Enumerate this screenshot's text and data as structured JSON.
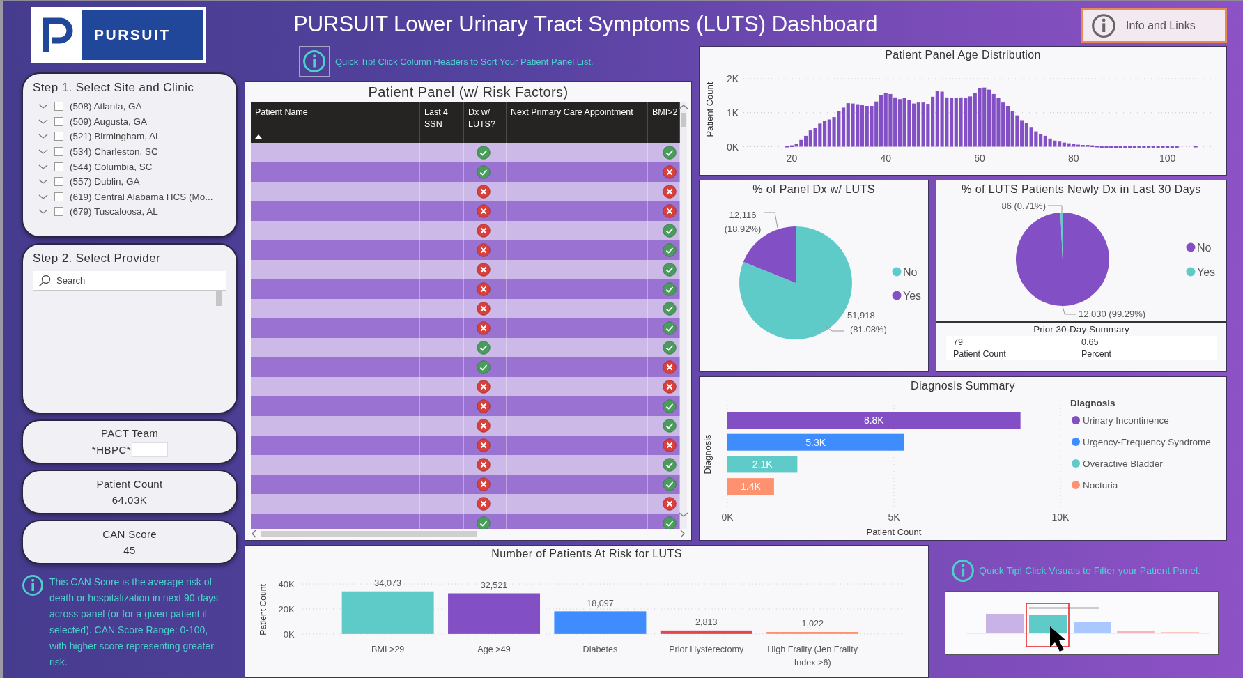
{
  "header": {
    "logo_text": "PURSUIT",
    "title": "PURSUIT Lower Urinary Tract Symptoms (LUTS) Dashboard",
    "info_button": "Info and Links"
  },
  "site_filter": {
    "title": "Step 1. Select Site and Clinic",
    "items": [
      {
        "label": "(508) Atlanta, GA",
        "checked": false
      },
      {
        "label": "(509) Augusta, GA",
        "checked": false
      },
      {
        "label": "(521) Birmingham, AL",
        "checked": false
      },
      {
        "label": "(534) Charleston, SC",
        "checked": false
      },
      {
        "label": "(544) Columbia, SC",
        "checked": false
      },
      {
        "label": "(557) Dublin, GA",
        "checked": false
      },
      {
        "label": "(619) Central Alabama HCS (Mo...",
        "checked": false
      },
      {
        "label": "(679) Tuscaloosa, AL",
        "checked": false
      }
    ]
  },
  "provider_filter": {
    "title": "Step 2. Select Provider",
    "search": {
      "placeholder": "Search"
    }
  },
  "cards": [
    {
      "label": "PACT Team",
      "value": "*HBPC*",
      "redacted": true
    },
    {
      "label": "Patient Count",
      "value": "64.03K",
      "redacted": false
    },
    {
      "label": "CAN Score",
      "value": "45",
      "redacted": false
    }
  ],
  "can_note": "This CAN Score is the average risk of death or hospitalization in next 90 days across panel (or for a given patient if selected). CAN Score Range: 0-100, with higher score representing greater risk.",
  "table_tip": "Quick Tip! Click Column Headers to Sort Your Patient Panel List.",
  "patient_panel": {
    "title": "Patient Panel (w/ Risk Factors)",
    "columns": [
      {
        "label": "Patient Name",
        "sorted": true
      },
      {
        "label": "Last 4 SSN",
        "sorted": false
      },
      {
        "label": "Dx w/ LUTS?",
        "sorted": false
      },
      {
        "label": "Next Primary Care Appointment",
        "sorted": false
      },
      {
        "label": "BMI>2",
        "sorted": false
      }
    ],
    "rows": [
      {
        "dx_luts": true,
        "bmi_over_29": true
      },
      {
        "dx_luts": true,
        "bmi_over_29": false
      },
      {
        "dx_luts": false,
        "bmi_over_29": false
      },
      {
        "dx_luts": false,
        "bmi_over_29": false
      },
      {
        "dx_luts": false,
        "bmi_over_29": true
      },
      {
        "dx_luts": false,
        "bmi_over_29": true
      },
      {
        "dx_luts": false,
        "bmi_over_29": true
      },
      {
        "dx_luts": false,
        "bmi_over_29": true
      },
      {
        "dx_luts": false,
        "bmi_over_29": true
      },
      {
        "dx_luts": false,
        "bmi_over_29": true
      },
      {
        "dx_luts": true,
        "bmi_over_29": true
      },
      {
        "dx_luts": true,
        "bmi_over_29": false
      },
      {
        "dx_luts": false,
        "bmi_over_29": false
      },
      {
        "dx_luts": false,
        "bmi_over_29": true
      },
      {
        "dx_luts": false,
        "bmi_over_29": true
      },
      {
        "dx_luts": false,
        "bmi_over_29": false
      },
      {
        "dx_luts": false,
        "bmi_over_29": true
      },
      {
        "dx_luts": false,
        "bmi_over_29": true
      },
      {
        "dx_luts": false,
        "bmi_over_29": false
      },
      {
        "dx_luts": true,
        "bmi_over_29": true
      }
    ]
  },
  "age_distribution": {
    "title": "Patient Panel Age Distribution",
    "chart_data": {
      "type": "bar",
      "ylabel": "Patient Count",
      "xlim": [
        10,
        110
      ],
      "x": [
        19,
        20,
        21,
        22,
        23,
        24,
        25,
        26,
        27,
        28,
        29,
        30,
        31,
        32,
        33,
        34,
        35,
        36,
        37,
        38,
        39,
        40,
        41,
        42,
        43,
        44,
        45,
        46,
        47,
        48,
        49,
        50,
        51,
        52,
        53,
        54,
        55,
        56,
        57,
        58,
        59,
        60,
        61,
        62,
        63,
        64,
        65,
        66,
        67,
        68,
        69,
        70,
        71,
        72,
        73,
        74,
        75,
        76,
        77,
        78,
        79,
        80,
        81,
        82,
        83,
        84,
        85,
        86,
        87,
        88,
        89,
        90,
        91,
        92,
        93,
        94,
        95,
        96,
        97,
        98,
        99,
        100,
        101,
        102,
        106
      ],
      "series": [
        {
          "color": "#8250c4",
          "values": [
            30,
            40,
            80,
            200,
            320,
            480,
            550,
            680,
            750,
            800,
            870,
            1050,
            1150,
            1280,
            1270,
            1250,
            1220,
            1200,
            1200,
            1330,
            1520,
            1570,
            1550,
            1450,
            1400,
            1430,
            1380,
            1270,
            1300,
            1300,
            1260,
            1470,
            1650,
            1620,
            1450,
            1430,
            1430,
            1450,
            1430,
            1480,
            1580,
            1720,
            1740,
            1680,
            1550,
            1430,
            1300,
            1200,
            1050,
            920,
            780,
            700,
            580,
            450,
            370,
            320,
            240,
            180,
            150,
            120,
            100,
            80,
            60,
            50,
            50,
            40,
            30,
            20,
            20,
            20,
            20,
            20,
            20,
            20,
            20,
            20,
            20,
            20,
            20,
            20,
            20,
            20,
            20,
            20,
            30
          ]
        }
      ],
      "xticks": [
        20,
        40,
        60,
        80,
        100
      ],
      "yticks": [
        {
          "value": 0,
          "label": "0K"
        },
        {
          "value": 1000,
          "label": "1K"
        },
        {
          "value": 2000,
          "label": "2K"
        }
      ],
      "ylim": [
        0,
        2000
      ]
    }
  },
  "dx_share": {
    "title": "% of Panel Dx w/ LUTS",
    "chart_data": {
      "type": "pie",
      "legend": "right",
      "categories": [
        "No",
        "Yes"
      ],
      "values": [
        51918,
        12116
      ],
      "colors": [
        "#5ecbc8",
        "#8250c4"
      ],
      "value_labels": [
        "51,918 (81.08%)",
        "12,116 (18.92%)"
      ]
    }
  },
  "new_dx": {
    "title": "% of LUTS Patients Newly Dx in Last 30 Days",
    "chart_data": {
      "type": "pie",
      "legend": "right",
      "categories": [
        "No",
        "Yes"
      ],
      "values": [
        12030,
        86
      ],
      "colors": [
        "#8250c4",
        "#5ecbc8"
      ],
      "value_labels": [
        "12,030 (99.29%)",
        "86 (0.71%)"
      ]
    },
    "summary": {
      "title": "Prior 30-Day Summary",
      "fields": [
        {
          "value": "79",
          "label": "Patient Count"
        },
        {
          "value": "0.65",
          "label": "Percent"
        }
      ]
    }
  },
  "diagnosis_summary": {
    "title": "Diagnosis Summary",
    "legend_title": "Diagnosis",
    "chart_data": {
      "type": "bar",
      "orientation": "horizontal",
      "xlabel": "Patient Count",
      "ylabel": "Diagnosis",
      "categories": [
        "Urinary Incontinence",
        "Urgency-Frequency Syndrome",
        "Overactive Bladder",
        "Nocturia"
      ],
      "values": [
        8800,
        5300,
        2100,
        1400
      ],
      "colors": [
        "#8250c4",
        "#3f8cff",
        "#5ecbc8",
        "#fe9170"
      ],
      "value_labels": [
        "8.8K",
        "5.3K",
        "2.1K",
        "1.4K"
      ],
      "xlim": [
        0,
        10000
      ],
      "xticks": [
        {
          "value": 0,
          "label": "0K"
        },
        {
          "value": 5000,
          "label": "5K"
        },
        {
          "value": 10000,
          "label": "10K"
        }
      ]
    }
  },
  "risk_factors": {
    "title": "Number of Patients At Risk for LUTS",
    "chart_data": {
      "type": "bar",
      "ylabel": "Patient Count",
      "categories": [
        "BMI >29",
        "Age >49",
        "Diabetes",
        "Prior Hysterectomy",
        "High Frailty (Jen Frailty Index >6)"
      ],
      "values": [
        34073,
        32521,
        18097,
        2813,
        1022
      ],
      "colors": [
        "#5ecbc8",
        "#8250c4",
        "#3f8cff",
        "#e0484e",
        "#fe9170"
      ],
      "value_labels": [
        "34,073",
        "32,521",
        "18,097",
        "2,813",
        "1,022"
      ],
      "ylim": [
        0,
        40000
      ],
      "yticks": [
        {
          "value": 0,
          "label": "0K"
        },
        {
          "value": 20000,
          "label": "20K"
        },
        {
          "value": 40000,
          "label": "40K"
        }
      ]
    }
  },
  "filter_tip": {
    "text": "Quick Tip! Click Visuals to Filter your Patient Panel."
  }
}
